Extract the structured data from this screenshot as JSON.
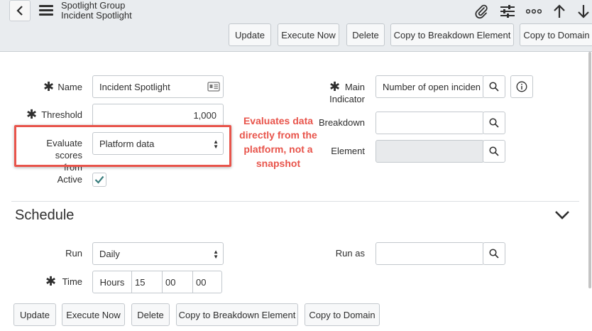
{
  "header": {
    "title_line1": "Spotlight Group",
    "title_line2": "Incident Spotlight",
    "icons": [
      "back-icon",
      "menu-icon",
      "attachment-icon",
      "settings-sliders-icon",
      "more-icon",
      "up-arrow-icon",
      "down-arrow-icon"
    ]
  },
  "toolbar": {
    "update": "Update",
    "execute_now": "Execute Now",
    "delete": "Delete",
    "copy_breakdown": "Copy to Breakdown Element",
    "copy_domain": "Copy to Domain"
  },
  "form": {
    "name_label": "Name",
    "name_value": "Incident Spotlight",
    "threshold_label": "Threshold",
    "threshold_value": "1,000",
    "evaluate_label_1": "Evaluate scores",
    "evaluate_label_2": "from",
    "evaluate_value": "Platform data",
    "active_label": "Active",
    "active_checked": true,
    "main_indicator_label_1": "Main",
    "main_indicator_label_2": "Indicator",
    "main_indicator_value": "Number of open inciden",
    "breakdown_label": "Breakdown",
    "breakdown_value": "",
    "element_label": "Element",
    "element_value": ""
  },
  "callout": {
    "line1": "Evaluates data",
    "line2": "directly from the",
    "line3": "platform, not a",
    "line4": "snapshot",
    "color": "#e8544b"
  },
  "schedule": {
    "title": "Schedule",
    "run_label": "Run",
    "run_value": "Daily",
    "run_as_label": "Run as",
    "run_as_value": "",
    "time_label": "Time",
    "time_prefix": "Hours",
    "time_hours": "15",
    "time_minutes": "00",
    "time_seconds": "00"
  },
  "bottom": {
    "update": "Update",
    "execute_now": "Execute Now",
    "delete": "Delete",
    "copy_breakdown": "Copy to Breakdown Element",
    "copy_domain": "Copy to Domain"
  }
}
